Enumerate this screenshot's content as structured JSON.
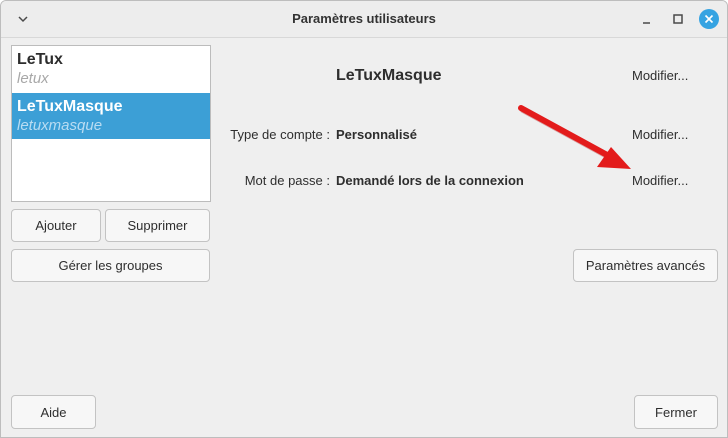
{
  "window": {
    "title": "Paramètres utilisateurs"
  },
  "users": [
    {
      "name": "LeTux",
      "login": "letux",
      "selected": false
    },
    {
      "name": "LeTuxMasque",
      "login": "letuxmasque",
      "selected": true
    }
  ],
  "buttons": {
    "add": "Ajouter",
    "remove": "Supprimer",
    "groups": "Gérer les groupes",
    "advanced": "Paramètres avancés",
    "help": "Aide",
    "close": "Fermer"
  },
  "details": {
    "username": "LeTuxMasque",
    "username_modify": "Modifier...",
    "account_type_label": "Type de compte :",
    "account_type_value": "Personnalisé",
    "account_type_modify": "Modifier...",
    "password_label": "Mot de passe :",
    "password_value": "Demandé lors de la connexion",
    "password_modify": "Modifier..."
  },
  "colors": {
    "selection": "#3c9fd6",
    "close_button": "#35a3e2",
    "annotation_arrow": "#e31b1b"
  },
  "icons": {
    "menu": "chevron-down-icon",
    "minimize": "minimize-icon",
    "maximize": "maximize-icon",
    "close": "close-icon"
  }
}
